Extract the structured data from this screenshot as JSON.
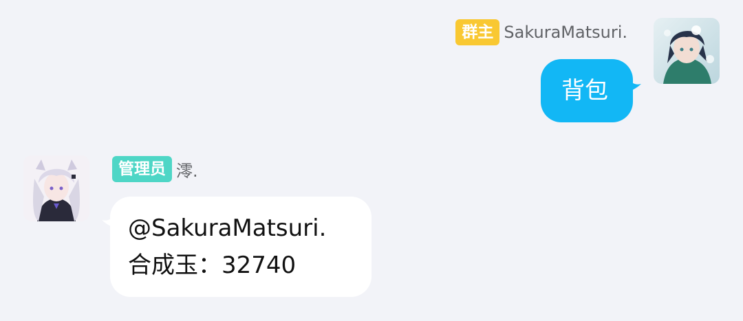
{
  "messages": [
    {
      "side": "right",
      "role_badge": "群主",
      "badge_color": "#f9c832",
      "sender": "SakuraMatsuri.",
      "bubble_color": "#12b7f5",
      "text_color": "#ffffff",
      "lines": [
        "背包"
      ]
    },
    {
      "side": "left",
      "role_badge": "管理员",
      "badge_color": "#4ed6c6",
      "sender": "澪.",
      "bubble_color": "#ffffff",
      "text_color": "#111111",
      "lines": [
        "@SakuraMatsuri.",
        "合成玉：32740"
      ]
    }
  ]
}
